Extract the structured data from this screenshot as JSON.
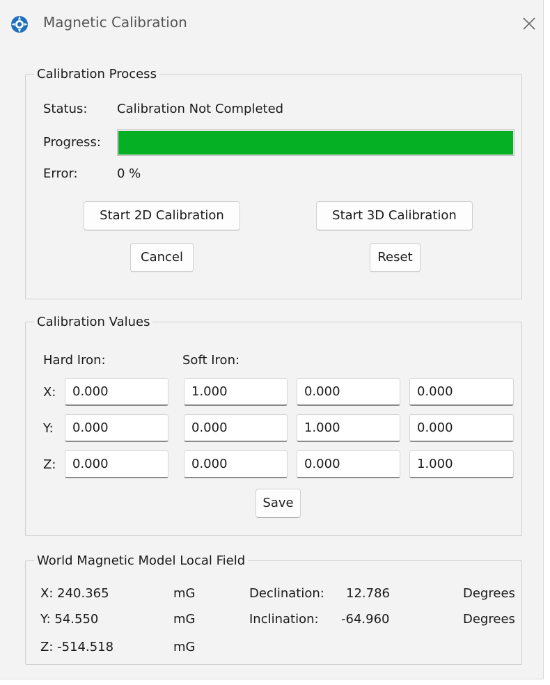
{
  "window": {
    "title": "Magnetic Calibration",
    "icon": "app-logo-icon",
    "close_icon": "close-icon"
  },
  "process": {
    "legend": "Calibration Process",
    "status_label": "Status:",
    "status_value": "Calibration Not Completed",
    "progress_label": "Progress:",
    "progress_fraction": 1.0,
    "progress_color": "#06b025",
    "error_label": "Error:",
    "error_value": "0 %",
    "start_2d": "Start 2D Calibration",
    "start_3d": "Start 3D Calibration",
    "cancel": "Cancel",
    "reset": "Reset"
  },
  "values": {
    "legend": "Calibration Values",
    "hard_iron_label": "Hard Iron:",
    "soft_iron_label": "Soft Iron:",
    "rows": [
      {
        "axis": "X:",
        "hard": "0.000",
        "soft": [
          "1.000",
          "0.000",
          "0.000"
        ]
      },
      {
        "axis": "Y:",
        "hard": "0.000",
        "soft": [
          "0.000",
          "1.000",
          "0.000"
        ]
      },
      {
        "axis": "Z:",
        "hard": "0.000",
        "soft": [
          "0.000",
          "0.000",
          "1.000"
        ]
      }
    ],
    "save": "Save"
  },
  "wmm": {
    "legend": "World Magnetic Model Local Field",
    "x": "X: 240.365",
    "y": "Y: 54.550",
    "z": "Z: -514.518",
    "unit": "mG",
    "declination_label": "Declination:",
    "declination_value": "12.786",
    "inclination_label": "Inclination:",
    "inclination_value": "-64.960",
    "angle_unit": "Degrees"
  }
}
